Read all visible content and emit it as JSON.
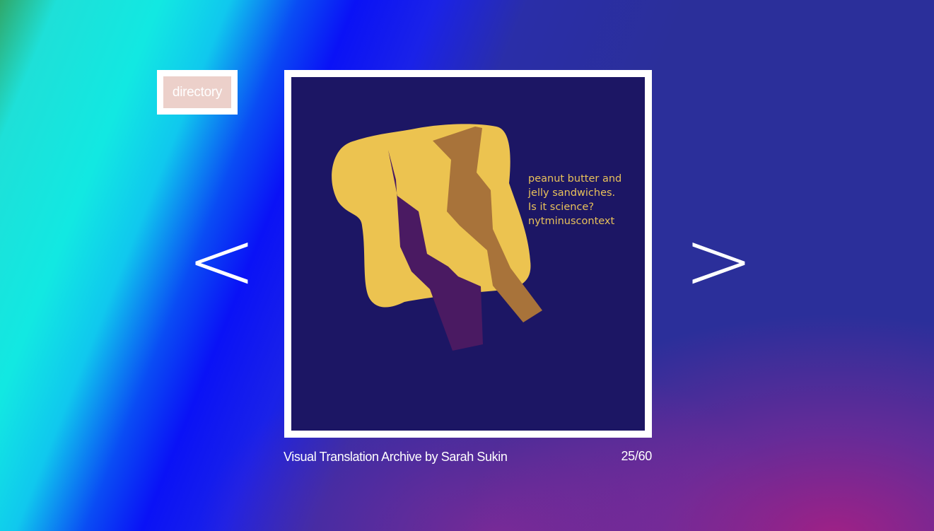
{
  "nav": {
    "directory_label": "directory",
    "prev_label": "<",
    "next_label": ">"
  },
  "artwork": {
    "caption_lines": [
      "peanut butter and",
      "jelly sandwiches.",
      "Is it science?",
      "nytminuscontext"
    ],
    "colors": {
      "background": "#1c1664",
      "bread": "#ecc350",
      "peanut_butter": "#a8733a",
      "jelly": "#4a1a62",
      "caption": "#e8c15a"
    }
  },
  "footer": {
    "title": "Visual Translation Archive by Sarah Sukin",
    "counter": "25/60"
  },
  "theme": {
    "frame": "#ffffff",
    "directory_fill": "#ecd0ca"
  }
}
